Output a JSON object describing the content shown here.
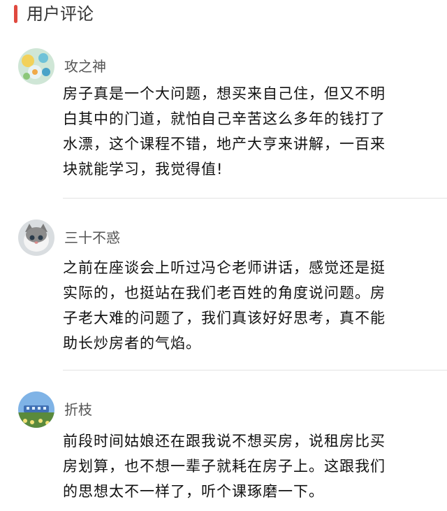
{
  "section": {
    "title": "用户评论",
    "accent_color": "#e0493f"
  },
  "comments": [
    {
      "avatar_icon": "flowers-avatar-icon",
      "username": "攻之神",
      "lines": [
        "房子真是一个大问题，想买来自己住，但又不明",
        "白其中的门道，就怕自己辛苦这么多年的钱打了",
        "水漂，这个课程不错，地产大亨来讲解，一百来",
        "块就能学习，我觉得值!"
      ]
    },
    {
      "avatar_icon": "cat-avatar-icon",
      "username": "三十不惑",
      "lines": [
        "之前在座谈会上听过冯仑老师讲话，感觉还是挺",
        "实际的，也挺站在我们老百姓的角度说问题。房",
        "子老大难的问题了，我们真该好好思考，真不能",
        "助长炒房者的气焰。"
      ]
    },
    {
      "avatar_icon": "landscape-avatar-icon",
      "username": "折枝",
      "lines": [
        "前段时间姑娘还在跟我说不想买房，说租房比买",
        "房划算，也不想一辈子就耗在房子上。这跟我们",
        "的思想太不一样了，听个课琢磨一下。"
      ]
    }
  ]
}
